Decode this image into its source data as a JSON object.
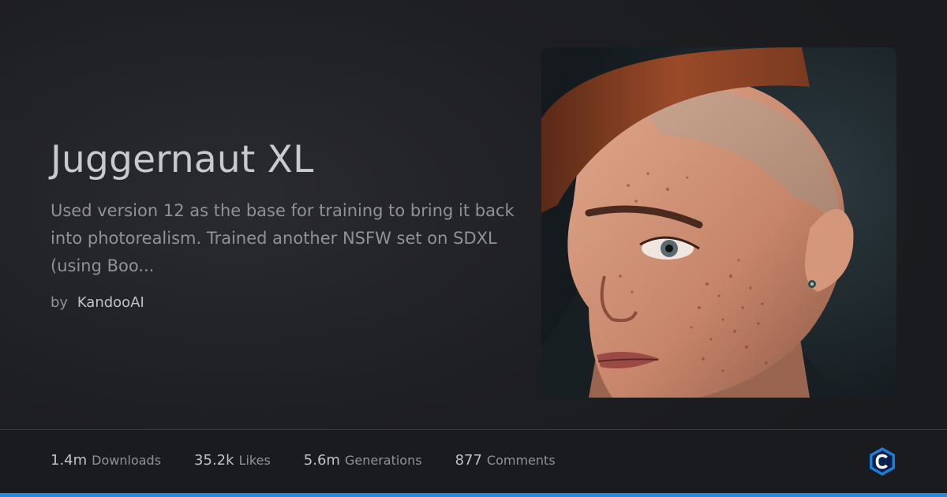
{
  "model": {
    "title": "Juggernaut XL",
    "description": "Used version 12 as the base for training to bring it back into photorealism. Trained another NSFW set on SDXL (using Boo...",
    "author_prefix": "by",
    "author": "KandooAI"
  },
  "stats": [
    {
      "value": "1.4m",
      "label": "Downloads"
    },
    {
      "value": "35.2k",
      "label": "Likes"
    },
    {
      "value": "5.6m",
      "label": "Generations"
    },
    {
      "value": "877",
      "label": "Comments"
    }
  ],
  "logo": {
    "icon": "civitai-logo-icon",
    "letter": "C",
    "color": "#1971c2"
  },
  "colors": {
    "accent": "#228be6",
    "background": "#1a1b1e"
  }
}
